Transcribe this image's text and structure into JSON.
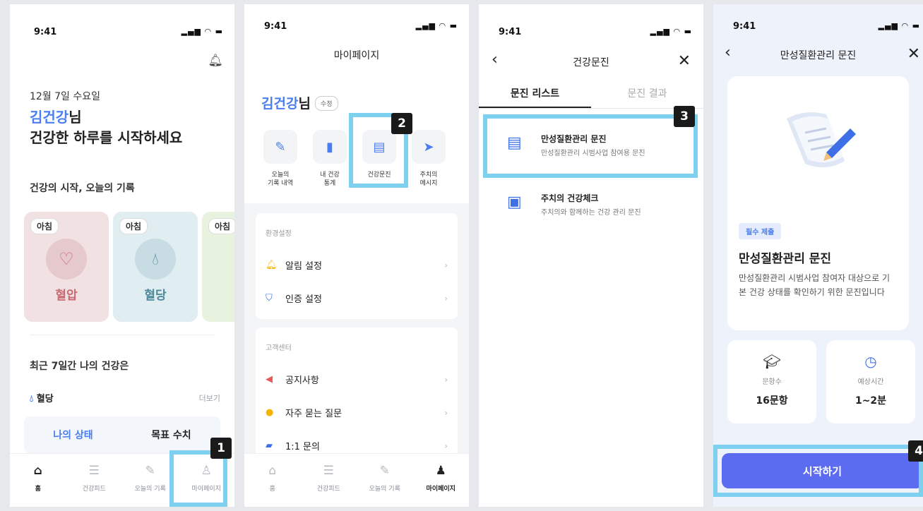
{
  "status": {
    "time": "9:41",
    "icons": "▂▄▆ ◠ ▬"
  },
  "screen1": {
    "date": "12월 7일 수요일",
    "user_name": "김건강",
    "name_suffix": "님",
    "greeting": "건강한 하루를 시작하세요",
    "section_record": "건강의 시작, 오늘의 기록",
    "cards": [
      {
        "tag": "아침",
        "label": "혈압",
        "color": "#f1e1e3",
        "label_color": "#c96a72"
      },
      {
        "tag": "아침",
        "label": "혈당",
        "color": "#e0edf1",
        "label_color": "#4c8a9a"
      },
      {
        "tag": "아침",
        "label": "",
        "color": "#e8f3df",
        "label_color": "#6a9a4c"
      }
    ],
    "section_recent": "최근 7일간 나의 건강은",
    "glucose_label": "혈당",
    "more": "더보기",
    "toggle": {
      "left": "나의 상태",
      "right": "목표 수치"
    },
    "badge": "1"
  },
  "nav": [
    {
      "label": "홈",
      "icon": "home-icon"
    },
    {
      "label": "건강피드",
      "icon": "feed-icon"
    },
    {
      "label": "오늘의 기록",
      "icon": "pencil-icon"
    },
    {
      "label": "마이페이지",
      "icon": "person-icon"
    }
  ],
  "screen2": {
    "title": "마이페이지",
    "user_name": "김건강",
    "suffix": "님",
    "edit": "수정",
    "menus": [
      {
        "label": "오늘의\n기록 내역",
        "icon": "pencil-icon"
      },
      {
        "label": "내 건강\n통계",
        "icon": "chart-icon"
      },
      {
        "label": "건강문진",
        "icon": "survey-icon"
      },
      {
        "label": "주치의\n메시지",
        "icon": "send-icon"
      }
    ],
    "settings_head": "환경설정",
    "settings": [
      {
        "label": "알림 설정"
      },
      {
        "label": "인증 설정"
      }
    ],
    "support_head": "고객센터",
    "support": [
      {
        "label": "공지사항"
      },
      {
        "label": "자주 묻는 질문"
      },
      {
        "label": "1:1 문의"
      }
    ],
    "badge": "2"
  },
  "screen3": {
    "title": "건강문진",
    "tab_list": "문진 리스트",
    "tab_result": "문진 결과",
    "items": [
      {
        "title": "만성질환관리 문진",
        "sub": "만성질환관리 시범사업 참여용 문진"
      },
      {
        "title": "주치의 건강체크",
        "sub": "주치의와 함께하는 건강 관리 문진"
      }
    ],
    "badge": "3"
  },
  "screen4": {
    "title": "만성질환관리 문진",
    "required": "필수 제출",
    "card_title": "만성질환관리 문진",
    "card_desc": "만성질환관리 시범사업 참여자 대상으로 기본 건강 상태를 확인하기 위한 문진입니다",
    "q_label": "문항수",
    "q_value": "16문항",
    "t_label": "예상시간",
    "t_value": "1~2분",
    "start": "시작하기",
    "badge": "4"
  },
  "colors": {
    "accent": "#4a7df0",
    "highlight": "#7dd0f0",
    "button": "#5b6cf0"
  }
}
